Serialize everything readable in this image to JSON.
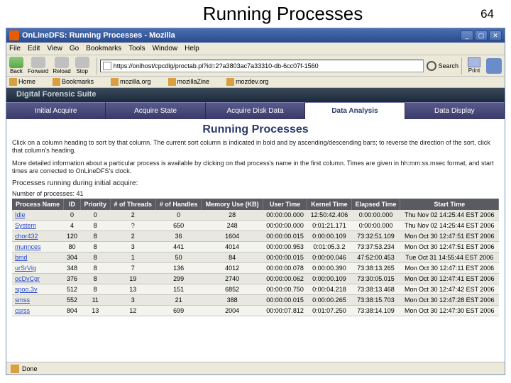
{
  "slide": {
    "title": "Running Processes",
    "number": "64"
  },
  "titlebar": {
    "text": "OnLineDFS: Running Processes - Mozilla"
  },
  "winbtns": {
    "min": "_",
    "max": "▢",
    "close": "✕"
  },
  "menu": {
    "file": "File",
    "edit": "Edit",
    "view": "View",
    "go": "Go",
    "bookmarks": "Bookmarks",
    "tools": "Tools",
    "window": "Window",
    "help": "Help"
  },
  "nav": {
    "back": "Back",
    "forward": "Forward",
    "reload": "Reload",
    "stop": "Stop",
    "search": "Search",
    "print": "Print"
  },
  "url": "https://onlhost/cpcdlg/proctab.pl?id=2?a3803ac7a33310-db-6cc07f-1560",
  "bookmarks": {
    "home": "Home",
    "bm": "Bookmarks",
    "mozilla": "mozilla.org",
    "mozillazine": "mozillaZine",
    "mozdev": "mozdev.org"
  },
  "banner": "Digital Forensic Suite",
  "tabs": {
    "t1": "Initial Acquire",
    "t2": "Acquire State",
    "t3": "Acquire Disk Data",
    "t4": "Data Analysis",
    "t5": "Data Display"
  },
  "page": {
    "title": "Running Processes",
    "instr1": "Click on a column heading to sort by that column. The current sort column is indicated in bold and by ascending/descending bars; to reverse the direction of the sort, click that column's heading.",
    "instr2": "More detailed information about a particular process is available by clicking on that process's name in the first column. Times are given in hh:mm:ss.msec format, and start times are corrected to OnLineDFS's clock.",
    "sect": "Processes running during initial acquire:",
    "count": "Number of processes: 41"
  },
  "headers": {
    "name": "Process Name",
    "id": "ID",
    "pri": "Priority",
    "thr": "# of Threads",
    "han": "# of Handles",
    "mem": "Memory Use (KB)",
    "ut": "User Time",
    "kt": "Kernel Time",
    "et": "Elapsed Time",
    "st": "Start Time"
  },
  "rows": [
    {
      "name": "Idle",
      "id": "0",
      "pri": "0",
      "thr": "2",
      "han": "0",
      "mem": "28",
      "ut": "00:00:00.000",
      "kt": "12:50:42.406",
      "et": "0:00:00.000",
      "st": "Thu Nov 02 14:25:44 EST 2006"
    },
    {
      "name": "System",
      "id": "4",
      "pri": "8",
      "thr": "?",
      "han": "650",
      "mem": "248",
      "ut": "00:00:00.000",
      "kt": "0:01:21.171",
      "et": "0:00:00.000",
      "st": "Thu Nov 02 14:25:44 EST 2006"
    },
    {
      "name": "chor432",
      "id": "120",
      "pri": "8",
      "thr": "2",
      "han": "36",
      "mem": "1604",
      "ut": "00:00:00.015",
      "kt": "0:00:00.109",
      "et": "73:32:51.109",
      "st": "Mon Oct 30 12:47:51 EST 2006"
    },
    {
      "name": "munnces",
      "id": "80",
      "pri": "8",
      "thr": "3",
      "han": "441",
      "mem": "4014",
      "ut": "00:00:00.953",
      "kt": "0:01:05.3.2",
      "et": "73:37:53.234",
      "st": "Mon Oct 30 12:47:51 EST 2006"
    },
    {
      "name": "bmd",
      "id": "304",
      "pri": "8",
      "thr": "1",
      "han": "50",
      "mem": "84",
      "ut": "00:00:00.015",
      "kt": "0:00:00.046",
      "et": "47:52:00.453",
      "st": "Tue Oct 31 14:55:44 EST 2006"
    },
    {
      "name": "urSrVig",
      "id": "348",
      "pri": "8",
      "thr": "7",
      "han": "136",
      "mem": "4012",
      "ut": "00:00:00.078",
      "kt": "0:00:00.390",
      "et": "73:38:13.265",
      "st": "Mon Oct 30 12:47:11 EST 2006"
    },
    {
      "name": "ocDvCgr",
      "id": "376",
      "pri": "8",
      "thr": "19",
      "han": "299",
      "mem": "2740",
      "ut": "00:00:00.062",
      "kt": "0:00:00.109",
      "et": "73:30:05.015",
      "st": "Mon Oct 30 12:47:41 EST 2006"
    },
    {
      "name": "spoo.3v",
      "id": "512",
      "pri": "8",
      "thr": "13",
      "han": "151",
      "mem": "6852",
      "ut": "00:00:00.750",
      "kt": "0:00:04.218",
      "et": "73:38:13.468",
      "st": "Mon Oct 30 12:47:42 EST 2006"
    },
    {
      "name": "smss",
      "id": "552",
      "pri": "11",
      "thr": "3",
      "han": "21",
      "mem": "388",
      "ut": "00:00:00.015",
      "kt": "0:00:00.265",
      "et": "73:38:15.703",
      "st": "Mon Oct 30 12:47:28 EST 2006"
    },
    {
      "name": "csrss",
      "id": "804",
      "pri": "13",
      "thr": "12",
      "han": "699",
      "mem": "2004",
      "ut": "00:00:07.812",
      "kt": "0:01:07.250",
      "et": "73:38:14.109",
      "st": "Mon Oct 30 12:47:30 EST 2006"
    }
  ],
  "status": {
    "text": "Done"
  }
}
